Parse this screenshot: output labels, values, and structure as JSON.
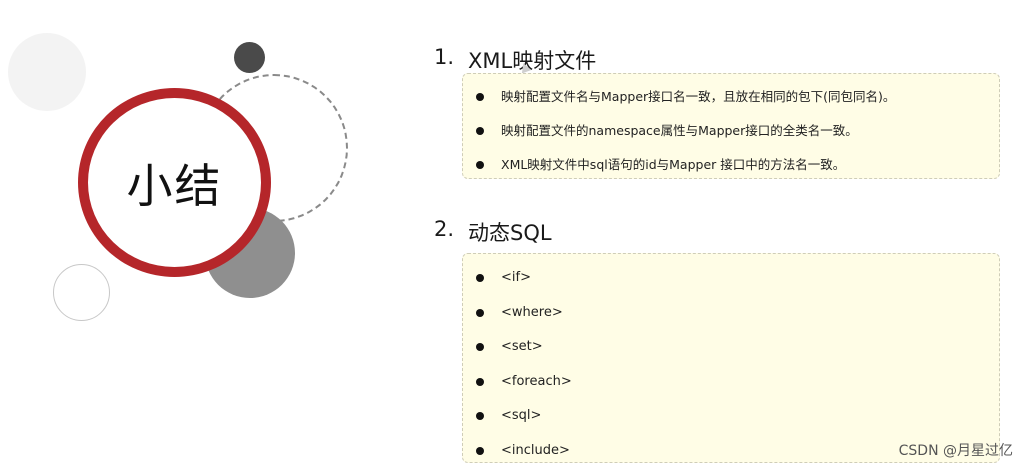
{
  "slide": {
    "badge_text": "小结",
    "sections": [
      {
        "number": "1.",
        "title": "XML映射文件",
        "items": [
          "映射配置文件名与Mapper接口名一致，且放在相同的包下(同包同名)。",
          "映射配置文件的namespace属性与Mapper接口的全类名一致。",
          "XML映射文件中sql语句的id与Mapper 接口中的方法名一致。"
        ]
      },
      {
        "number": "2.",
        "title": "动态SQL",
        "items": [
          "<if>",
          "<where>",
          "<set>",
          "<foreach>",
          "<sql>",
          "<include>"
        ]
      }
    ],
    "watermark": "CSDN @月星过亿"
  },
  "colors": {
    "ring": "#b5262a",
    "box_background": "#fffde6",
    "dark_dot": "#4a4a4a",
    "gray_circle": "#8f8f8f"
  }
}
